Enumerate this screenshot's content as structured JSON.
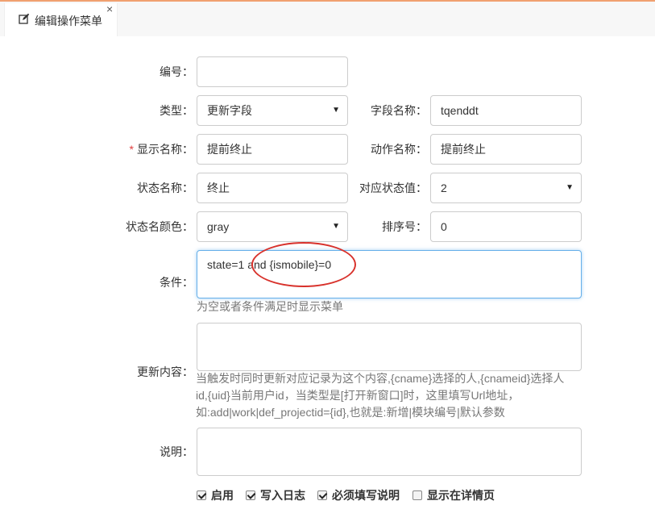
{
  "tab": {
    "title": "编辑操作菜单",
    "close_glyph": "×",
    "icon": "edit-icon"
  },
  "form": {
    "number": {
      "label": "编号：",
      "value": ""
    },
    "type": {
      "label": "类型：",
      "value": "更新字段"
    },
    "field_name": {
      "label": "字段名称：",
      "value": "tqenddt"
    },
    "display_name": {
      "required_mark": "*",
      "label": "显示名称：",
      "value": "提前终止"
    },
    "action_name": {
      "label": "动作名称：",
      "value": "提前终止"
    },
    "state_name": {
      "label": "状态名称：",
      "value": "终止"
    },
    "state_value": {
      "label": "对应状态值：",
      "value": "2"
    },
    "state_color": {
      "label": "状态名颜色：",
      "value": "gray"
    },
    "sort_no": {
      "label": "排序号：",
      "value": "0"
    },
    "condition": {
      "label": "条件：",
      "value": "state=1 and {ismobile}=0",
      "hint": "为空或者条件满足时显示菜单"
    },
    "update_content": {
      "label": "更新内容：",
      "value": "",
      "hint_lines": [
        "当触发时同时更新对应记录为这个内容,{cname}选择的人,{cnameid}选择人",
        "id,{uid}当前用户id，当类型是[打开新窗口]时，这里填写Url地址，",
        "如:add|work|def_projectid={id},也就是:新增|模块编号|默认参数"
      ]
    },
    "description": {
      "label": "说明：",
      "value": ""
    }
  },
  "checkboxes": [
    {
      "label": "启用",
      "checked": true
    },
    {
      "label": "写入日志",
      "checked": true
    },
    {
      "label": "必须填写说明",
      "checked": true
    },
    {
      "label": "显示在详情页",
      "checked": false
    }
  ],
  "annotation": {
    "color": "#d8322c"
  },
  "colors": {
    "accent_line": "#f0a070",
    "focus": "#66afe9",
    "required": "#e04040"
  }
}
